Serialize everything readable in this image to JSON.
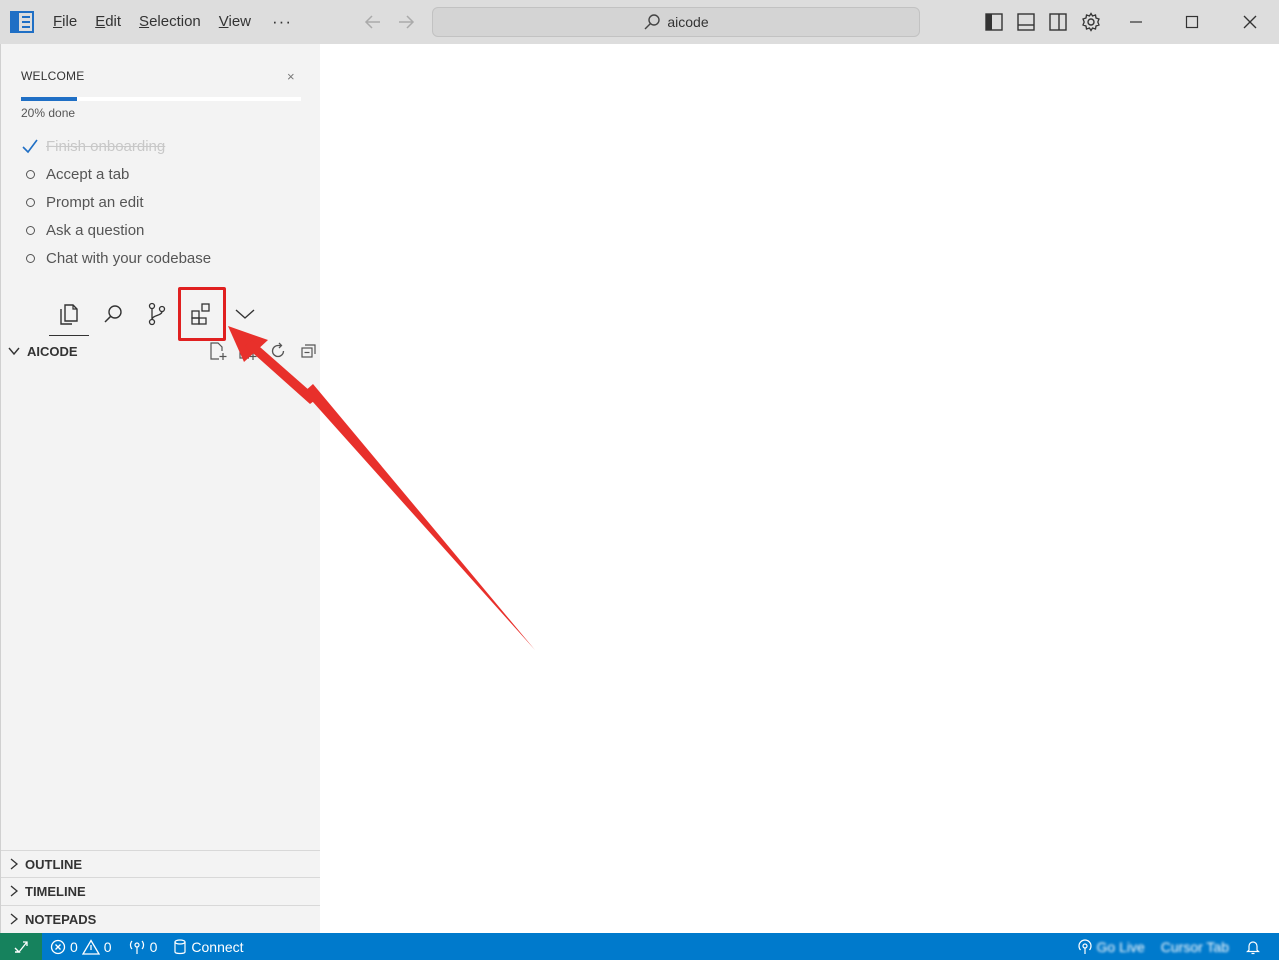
{
  "titlebar": {
    "menu": [
      {
        "first": "F",
        "rest": "ile"
      },
      {
        "first": "E",
        "rest": "dit"
      },
      {
        "first": "S",
        "rest": "election"
      },
      {
        "first": "V",
        "rest": "iew"
      }
    ],
    "more": "···",
    "search_text": "aicode"
  },
  "welcome": {
    "title": "WELCOME",
    "close": "×",
    "progress_percent": 20,
    "progress_text": "20% done",
    "items": [
      {
        "label": "Finish onboarding",
        "done": true
      },
      {
        "label": "Accept a tab",
        "done": false
      },
      {
        "label": "Prompt an edit",
        "done": false
      },
      {
        "label": "Ask a question",
        "done": false
      },
      {
        "label": "Chat with your codebase",
        "done": false
      }
    ]
  },
  "explorer": {
    "title": "AICODE"
  },
  "sections": {
    "outline": "OUTLINE",
    "timeline": "TIMELINE",
    "notepads": "NOTEPADS"
  },
  "statusbar": {
    "errors": "0",
    "warnings": "0",
    "ports": "0",
    "connect": "Connect",
    "right_text_1": "Go Live",
    "right_text_2": "Cursor Tab"
  },
  "colors": {
    "accent": "#007acc",
    "remote": "#16825d",
    "highlight": "#e02020",
    "progress": "#1f6fc5"
  },
  "icons": [
    "sidebar-layout-icon",
    "search-icon",
    "back-arrow-icon",
    "forward-arrow-icon",
    "panel-left-icon",
    "panel-bottom-icon",
    "panel-right-icon",
    "gear-icon",
    "minimize-icon",
    "maximize-icon",
    "close-icon",
    "files-icon",
    "source-control-icon",
    "extensions-icon",
    "chevron-down-icon",
    "new-file-icon",
    "new-folder-icon",
    "refresh-icon",
    "collapse-all-icon",
    "remote-icon",
    "error-icon",
    "warning-icon",
    "ports-icon",
    "database-icon",
    "broadcast-icon",
    "bell-icon"
  ]
}
